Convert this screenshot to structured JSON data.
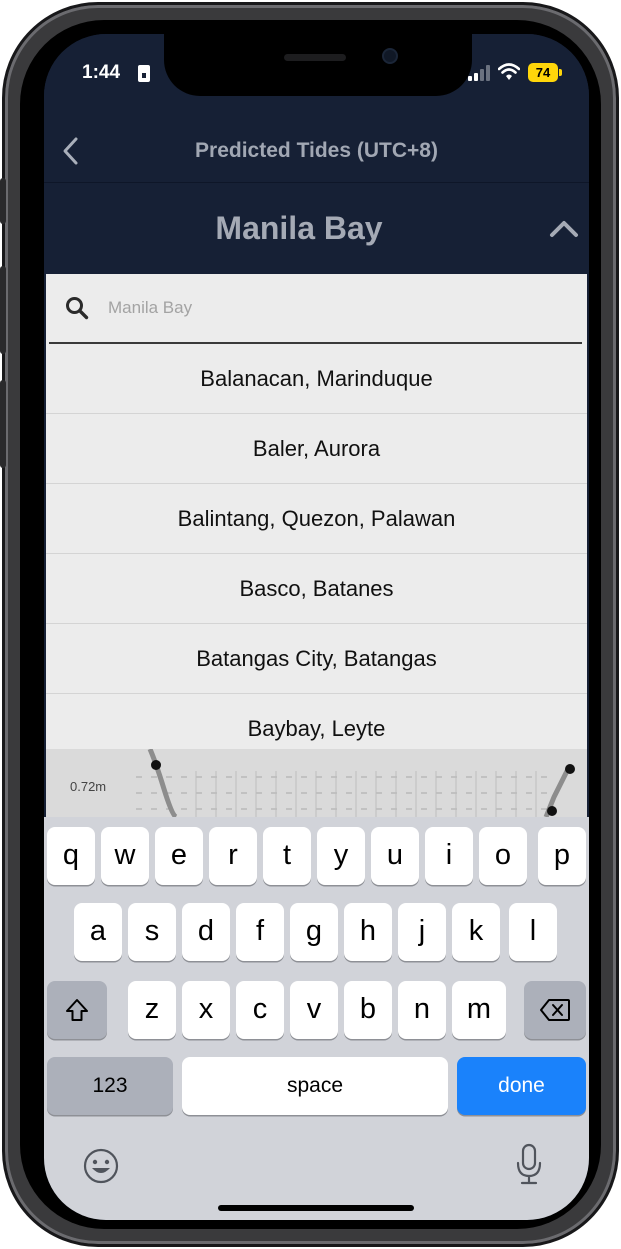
{
  "status_bar": {
    "time": "1:44",
    "battery": "74",
    "battery_color": "#ffd60a"
  },
  "nav": {
    "back_icon": "chevron-left-icon",
    "title": "Predicted Tides (UTC+8)"
  },
  "location_header": {
    "title": "Manila Bay",
    "toggle_icon": "chevron-up-icon"
  },
  "search": {
    "placeholder": "Manila Bay",
    "value": "",
    "icon": "search-icon"
  },
  "locations": [
    "Balanacan, Marinduque",
    "Baler, Aurora",
    "Balintang, Quezon, Palawan",
    "Basco, Batanes",
    "Batangas City, Batangas",
    "Baybay, Leyte"
  ],
  "chart_peek": {
    "label": "0.72m"
  },
  "keyboard": {
    "row1": [
      "q",
      "w",
      "e",
      "r",
      "t",
      "y",
      "u",
      "i",
      "o",
      "p"
    ],
    "row2": [
      "a",
      "s",
      "d",
      "f",
      "g",
      "h",
      "j",
      "k",
      "l"
    ],
    "row3": [
      "z",
      "x",
      "c",
      "v",
      "b",
      "n",
      "m"
    ],
    "numbers_label": "123",
    "space_label": "space",
    "done_label": "done",
    "done_color": "#1a82fb",
    "shift_icon": "shift-icon",
    "delete_icon": "delete-icon",
    "emoji_icon": "emoji-icon",
    "mic_icon": "microphone-icon"
  },
  "colors": {
    "header_bg": "#162035",
    "list_bg": "#ececec",
    "keyboard_bg": "#d1d3d9"
  }
}
